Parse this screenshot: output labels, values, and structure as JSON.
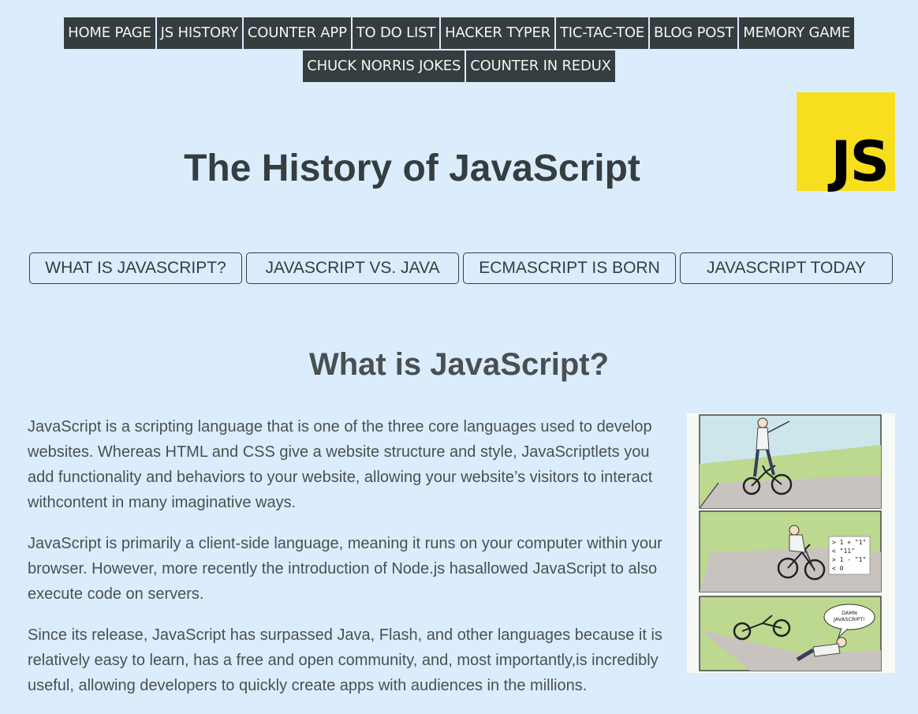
{
  "nav": {
    "items": [
      "HOME PAGE",
      "JS HISTORY",
      "COUNTER APP",
      "TO DO LIST",
      "HACKER TYPER",
      "TIC-TAC-TOE",
      "BLOG POST",
      "MEMORY GAME",
      "CHUCK NORRIS JOKES",
      "COUNTER IN REDUX"
    ]
  },
  "header": {
    "title": "The History of JavaScript",
    "logo_text": "JS"
  },
  "tabs": [
    "WHAT IS JAVASCRIPT?",
    "JAVASCRIPT VS. JAVA",
    "ECMASCRIPT IS BORN",
    "JAVASCRIPT TODAY"
  ],
  "section": {
    "title": "What is JavaScript?",
    "paragraphs": [
      "JavaScript is a scripting language that is one of the three core languages used to develop websites. Whereas HTML and CSS give a website structure and style, JavaScriptlets you add functionality and behaviors to your website, allowing your website’s visitors to interact withcontent in many imaginative ways.",
      "JavaScript is primarily a client-side language, meaning it runs on your computer within your browser. However, more recently the introduction of Node.js hasallowed JavaScript to also execute code on servers.",
      "Since its release, JavaScript has surpassed Java, Flash, and other languages because it is relatively easy to learn, has a free and open community, and, most importantly,is incredibly useful, allowing developers to quickly create apps with audiences in the millions."
    ]
  },
  "comic": {
    "console_lines": [
      "> 1 + \"1\"",
      "< \"11\"",
      "> 1 - \"1\"",
      "< 0"
    ],
    "speech_line1": "DAMN",
    "speech_line2": "JAVASCRIPT!"
  },
  "colors": {
    "background": "#dbedfd",
    "nav_bg": "#353d3f",
    "nav_text": "#f2f4f4",
    "logo_bg": "#f7df1e",
    "text": "#353d3f"
  }
}
